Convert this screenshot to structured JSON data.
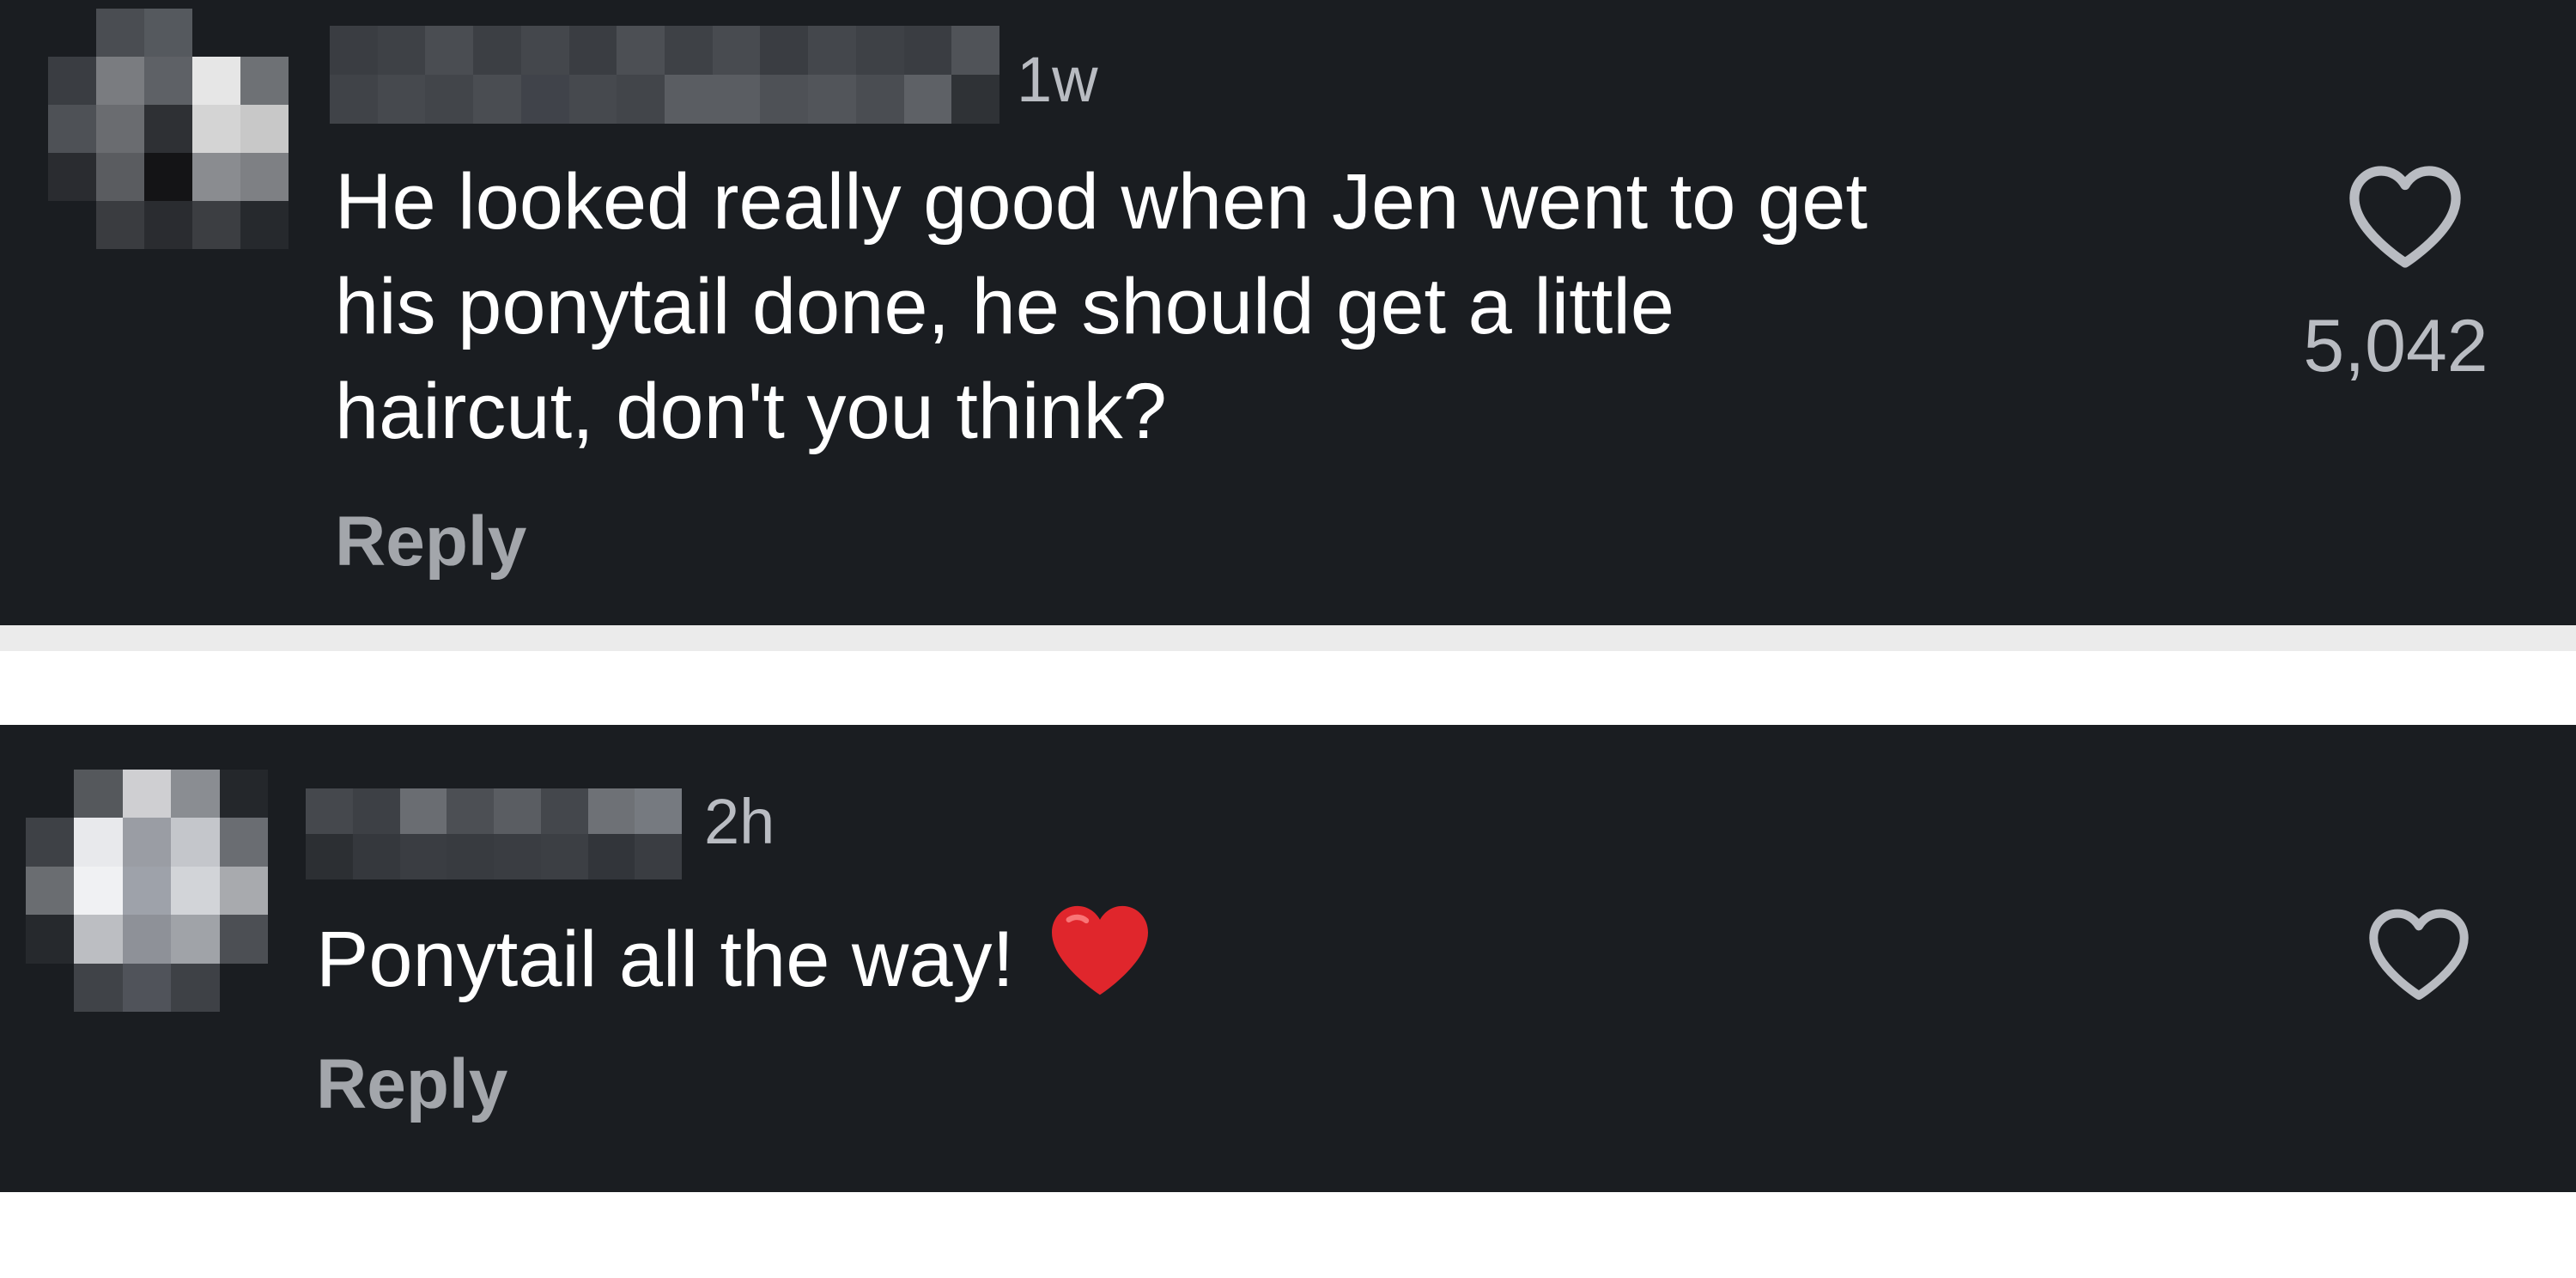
{
  "comments": [
    {
      "timestamp": "1w",
      "lines": [
        "He looked really good when Jen went to get",
        "his ponytail done, he should get a little",
        "haircut, don't you think?"
      ],
      "reply_label": "Reply",
      "like_count": "5,042",
      "like_icon": "heart-outline-icon"
    },
    {
      "timestamp": "2h",
      "text": "Ponytail all the way!",
      "emoji": "red-heart-emoji",
      "reply_label": "Reply",
      "like_icon": "heart-outline-icon"
    }
  ],
  "colors": {
    "background": "#1a1d21",
    "text": "#ffffff",
    "muted": "#b9bcc2",
    "separator": "#ebebeb",
    "emoji_heart": "#e0262c"
  }
}
